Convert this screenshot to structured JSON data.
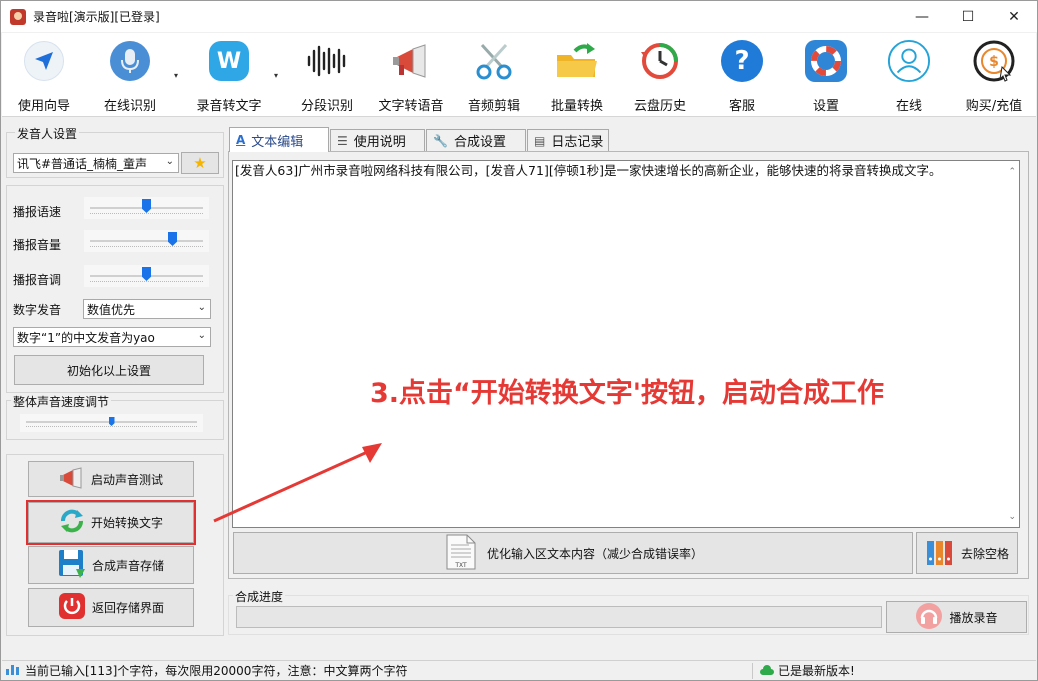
{
  "window": {
    "title": "录音啦[演示版][已登录]",
    "controls": {
      "minimize": "—",
      "maximize": "☐",
      "close": "✕"
    }
  },
  "toolbar": {
    "items": [
      {
        "label": "使用向导",
        "icon": "navigation-arrow-icon"
      },
      {
        "label": "在线识别",
        "icon": "microphone-icon",
        "has_dropdown": true
      },
      {
        "label": "录音转文字",
        "icon": "w-logo-icon",
        "has_dropdown": true
      },
      {
        "label": "分段识别",
        "icon": "waveform-icon"
      },
      {
        "label": "文字转语音",
        "icon": "megaphone-icon"
      },
      {
        "label": "音频剪辑",
        "icon": "scissors-icon"
      },
      {
        "label": "批量转换",
        "icon": "folder-export-icon"
      },
      {
        "label": "云盘历史",
        "icon": "history-clock-icon"
      },
      {
        "label": "客服",
        "icon": "help-question-icon"
      },
      {
        "label": "设置",
        "icon": "lifebuoy-icon"
      },
      {
        "label": "在线",
        "icon": "user-profile-icon"
      },
      {
        "label": "购买/充值",
        "icon": "dollar-coin-icon"
      }
    ],
    "dropdown_glyph": "▾"
  },
  "speaker_settings": {
    "group_title": "发音人设置",
    "voice_selected": "讯飞#普通话_楠楠_童声",
    "favorite_icon": "star-icon",
    "speed_label": "播报语速",
    "speed_value": 0.5,
    "volume_label": "播报音量",
    "volume_value": 0.75,
    "pitch_label": "播报音调",
    "pitch_value": 0.5,
    "digit_label": "数字发音",
    "digit_selected": "数值优先",
    "one_pron_selected": "数字“1”的中文发音为yao",
    "reset_button": "初始化以上设置"
  },
  "overall_speed": {
    "group_title": "整体声音速度调节",
    "value": 0.5
  },
  "actions": {
    "test_voice": "启动声音测试",
    "start_convert": "开始转换文字",
    "save_audio": "合成声音存储",
    "back_save": "返回存储界面"
  },
  "tabs": [
    {
      "label": "文本编辑",
      "icon": "text-a-icon",
      "active": true
    },
    {
      "label": "使用说明",
      "icon": "list-icon",
      "active": false
    },
    {
      "label": "合成设置",
      "icon": "wrench-icon",
      "active": false
    },
    {
      "label": "日志记录",
      "icon": "document-icon",
      "active": false
    }
  ],
  "editor": {
    "content": "[发音人63]广州市录音啦网络科技有限公司，[发音人71][停顿1秒]是一家快速增长的高新企业，能够快速的将录音转换成文字。"
  },
  "annotation": {
    "text": "3.点击“开始转换文字'按钮，启动合成工作",
    "color": "#e53935"
  },
  "editor_buttons": {
    "optimize": "优化输入区文本内容（减少合成错误率）",
    "remove_spaces": "去除空格"
  },
  "progress": {
    "group_title": "合成进度",
    "value": 0,
    "play_button": "播放录音"
  },
  "status": {
    "left": "当前已输入[113]个字符，每次限用20000字符，注意：中文算两个字符",
    "right": "已是最新版本!"
  }
}
